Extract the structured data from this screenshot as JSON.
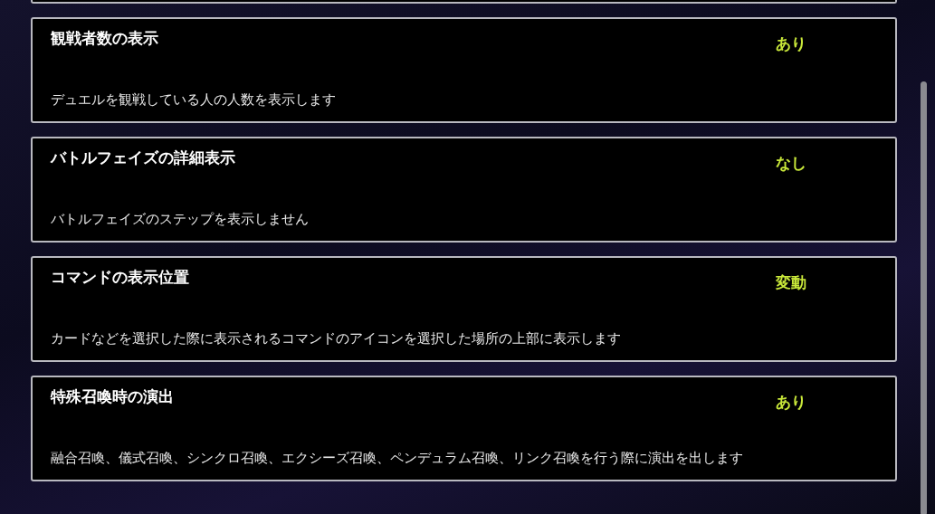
{
  "settings": [
    {
      "title": "観戦者数の表示",
      "value": "あり",
      "description": "デュエルを観戦している人の人数を表示します"
    },
    {
      "title": "バトルフェイズの詳細表示",
      "value": "なし",
      "description": "バトルフェイズのステップを表示しません"
    },
    {
      "title": "コマンドの表示位置",
      "value": "変動",
      "description": "カードなどを選択した際に表示されるコマンドのアイコンを選択した場所の上部に表示します"
    },
    {
      "title": "特殊召喚時の演出",
      "value": "あり",
      "description": "融合召喚、儀式召喚、シンクロ召喚、エクシーズ召喚、ペンデュラム召喚、リンク召喚を行う際に演出を出します"
    }
  ]
}
